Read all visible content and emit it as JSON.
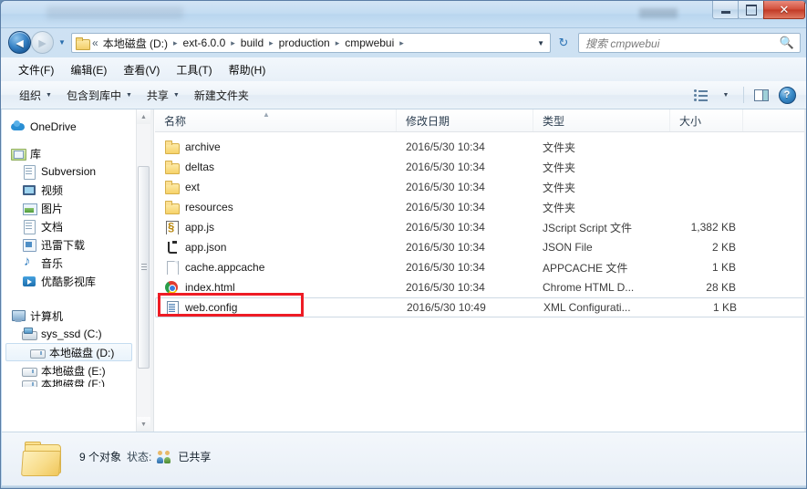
{
  "window": {
    "title": "",
    "controls": {
      "minimize": "Minimize",
      "maximize": "Maximize",
      "close": "✕"
    }
  },
  "navigation": {
    "back_label": "◄",
    "forward_label": "►",
    "history_dropdown": "▼",
    "refresh_label": "↻"
  },
  "breadcrumb": {
    "overflow": "«",
    "segments": [
      "本地磁盘 (D:)",
      "ext-6.0.0",
      "build",
      "production",
      "cmpwebui"
    ],
    "separator": "▸",
    "dropdown": "▼"
  },
  "search": {
    "placeholder": "搜索 cmpwebui",
    "value": "",
    "icon": "search-icon"
  },
  "menubar": {
    "items": [
      {
        "label": "文件(F)"
      },
      {
        "label": "编辑(E)"
      },
      {
        "label": "查看(V)"
      },
      {
        "label": "工具(T)"
      },
      {
        "label": "帮助(H)"
      }
    ]
  },
  "commandbar": {
    "items": [
      {
        "label": "组织",
        "caret": "▼"
      },
      {
        "label": "包含到库中",
        "caret": "▼"
      },
      {
        "label": "共享",
        "caret": "▼"
      },
      {
        "label": "新建文件夹",
        "caret": ""
      }
    ],
    "right_icons": [
      {
        "name": "change-view-icon",
        "caret": "▼"
      },
      {
        "name": "preview-pane-icon"
      },
      {
        "name": "help-icon",
        "glyph": "?"
      }
    ]
  },
  "nav_pane": {
    "groups": [
      {
        "items": [
          {
            "label": "OneDrive",
            "icon": "onedrive-icon",
            "level": 0,
            "selected": false
          }
        ]
      },
      {
        "items": [
          {
            "label": "库",
            "icon": "library-icon",
            "level": 0,
            "selected": false
          },
          {
            "label": "Subversion",
            "icon": "document-icon",
            "level": 1,
            "selected": false
          },
          {
            "label": "视频",
            "icon": "video-icon",
            "level": 1,
            "selected": false
          },
          {
            "label": "图片",
            "icon": "picture-icon",
            "level": 1,
            "selected": false
          },
          {
            "label": "文档",
            "icon": "document-icon",
            "level": 1,
            "selected": false
          },
          {
            "label": "迅雷下载",
            "icon": "download-icon",
            "level": 1,
            "selected": false
          },
          {
            "label": "音乐",
            "icon": "music-icon",
            "level": 1,
            "selected": false
          },
          {
            "label": "优酷影视库",
            "icon": "youku-icon",
            "level": 1,
            "selected": false
          }
        ]
      },
      {
        "items": [
          {
            "label": "计算机",
            "icon": "computer-icon",
            "level": 0,
            "selected": false
          },
          {
            "label": "sys_ssd (C:)",
            "icon": "system-drive-icon",
            "level": 1,
            "selected": false
          },
          {
            "label": "本地磁盘 (D:)",
            "icon": "drive-icon",
            "level": 1,
            "selected": true
          },
          {
            "label": "本地磁盘 (E:)",
            "icon": "drive-icon",
            "level": 1,
            "selected": false
          },
          {
            "label": "本地磁盘 (F:)",
            "icon": "drive-icon",
            "level": 1,
            "selected": false
          }
        ]
      }
    ],
    "scrollbar": {
      "up": "▲",
      "down": "▼"
    }
  },
  "file_list": {
    "columns": [
      {
        "key": "name",
        "label": "名称"
      },
      {
        "key": "date",
        "label": "修改日期"
      },
      {
        "key": "type",
        "label": "类型"
      },
      {
        "key": "size",
        "label": "大小"
      }
    ],
    "sort_indicator": "▲",
    "rows": [
      {
        "name": "archive",
        "date": "2016/5/30 10:34",
        "type": "文件夹",
        "size": "",
        "icon": "folder-icon",
        "selected": false
      },
      {
        "name": "deltas",
        "date": "2016/5/30 10:34",
        "type": "文件夹",
        "size": "",
        "icon": "folder-icon",
        "selected": false
      },
      {
        "name": "ext",
        "date": "2016/5/30 10:34",
        "type": "文件夹",
        "size": "",
        "icon": "folder-icon",
        "selected": false
      },
      {
        "name": "resources",
        "date": "2016/5/30 10:34",
        "type": "文件夹",
        "size": "",
        "icon": "folder-icon",
        "selected": false
      },
      {
        "name": "app.js",
        "date": "2016/5/30 10:34",
        "type": "JScript Script 文件",
        "size": "1,382 KB",
        "icon": "jscript-icon",
        "selected": false
      },
      {
        "name": "app.json",
        "date": "2016/5/30 10:34",
        "type": "JSON File",
        "size": "2 KB",
        "icon": "json-icon",
        "selected": false
      },
      {
        "name": "cache.appcache",
        "date": "2016/5/30 10:34",
        "type": "APPCACHE 文件",
        "size": "1 KB",
        "icon": "blank-doc-icon",
        "selected": false
      },
      {
        "name": "index.html",
        "date": "2016/5/30 10:34",
        "type": "Chrome HTML D...",
        "size": "28 KB",
        "icon": "chrome-icon",
        "selected": false
      },
      {
        "name": "web.config",
        "date": "2016/5/30 10:49",
        "type": "XML Configurati...",
        "size": "1 KB",
        "icon": "xml-config-icon",
        "selected": true
      }
    ]
  },
  "annotation": {
    "color": "#ee1c25",
    "target": "web.config"
  },
  "details_pane": {
    "item_count": "9 个对象",
    "state_label": "状态:",
    "state_value": "已共享",
    "share_icon": "shared-users-icon"
  },
  "colors": {
    "accent": "#2a6fae",
    "annotation": "#ee1c25",
    "titlebar": "#c3dcf2",
    "close_button": "#c13a26"
  }
}
